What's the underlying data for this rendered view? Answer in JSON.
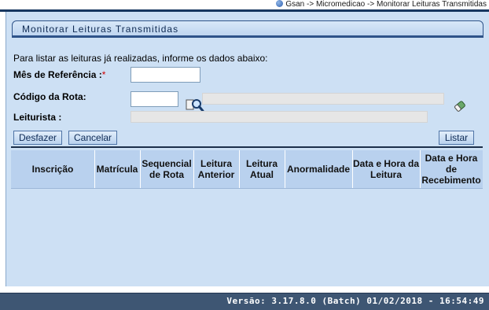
{
  "breadcrumb": {
    "text": "Gsan -> Micromedicao -> Monitorar Leituras Transmitidas",
    "icon": "globe-icon"
  },
  "page": {
    "title": "Monitorar Leituras Transmitidas"
  },
  "form": {
    "intro": "Para listar as leituras já realizadas, informe os dados abaixo:",
    "mes_referencia": {
      "label": "Mês de Referência :",
      "required_mark": "*",
      "value": ""
    },
    "codigo_rota": {
      "label": "Código da Rota:",
      "value": "",
      "description": "",
      "search_icon": "search-icon",
      "clear_icon": "eraser-icon"
    },
    "leiturista": {
      "label": "Leiturista :",
      "value": ""
    }
  },
  "buttons": {
    "desfazer": "Desfazer",
    "cancelar": "Cancelar",
    "listar": "Listar"
  },
  "table": {
    "columns": [
      "Inscrição",
      "Matrícula",
      "Sequencial de Rota",
      "Leitura Anterior",
      "Leitura Atual",
      "Anormalidade",
      "Data e Hora da Leitura",
      "Data e Hora de Recebimento"
    ],
    "rows": []
  },
  "footer": {
    "version": "Versão: 3.17.8.0 (Batch) 01/02/2018 - 16:54:49"
  },
  "colors": {
    "panel_bg": "#cde0f4",
    "header_bg": "#b9d1ee",
    "footer_bg": "#3e5673",
    "border": "#2e5389",
    "required": "#d00000"
  }
}
